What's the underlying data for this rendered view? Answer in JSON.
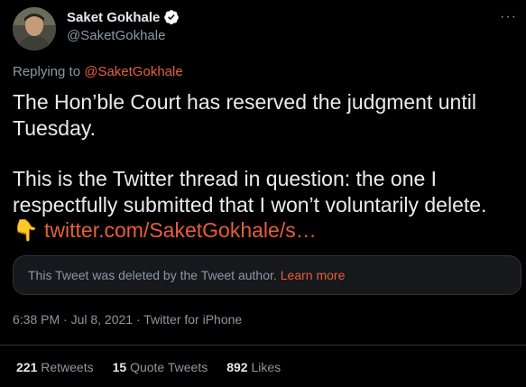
{
  "author": {
    "name": "Saket Gokhale",
    "handle": "@SaketGokhale",
    "verified_icon": "verified-badge-icon",
    "more_icon": "more-options-icon"
  },
  "replying": {
    "prefix": "Replying to ",
    "handle": "@SaketGokhale"
  },
  "tweet": {
    "line1": "The Hon’ble Court has reserved the judgment until Tuesday.",
    "line2": "This is the Twitter thread in question: the one I respectfully submitted that I won’t voluntarily delete.",
    "emoji": "👇",
    "link": "twitter.com/SaketGokhale/s…"
  },
  "deleted_notice": {
    "text": "This Tweet was deleted by the Tweet author.",
    "link": "Learn more"
  },
  "meta": {
    "text": "6:38 PM · Jul 8, 2021 · Twitter for iPhone"
  },
  "stats": [
    {
      "count": "221",
      "label": "Retweets"
    },
    {
      "count": "15",
      "label": "Quote Tweets"
    },
    {
      "count": "892",
      "label": "Likes"
    }
  ],
  "colors": {
    "background": "#000000",
    "link": "#e65f3a",
    "muted": "#8b98a5",
    "verified": "#ffffff"
  }
}
